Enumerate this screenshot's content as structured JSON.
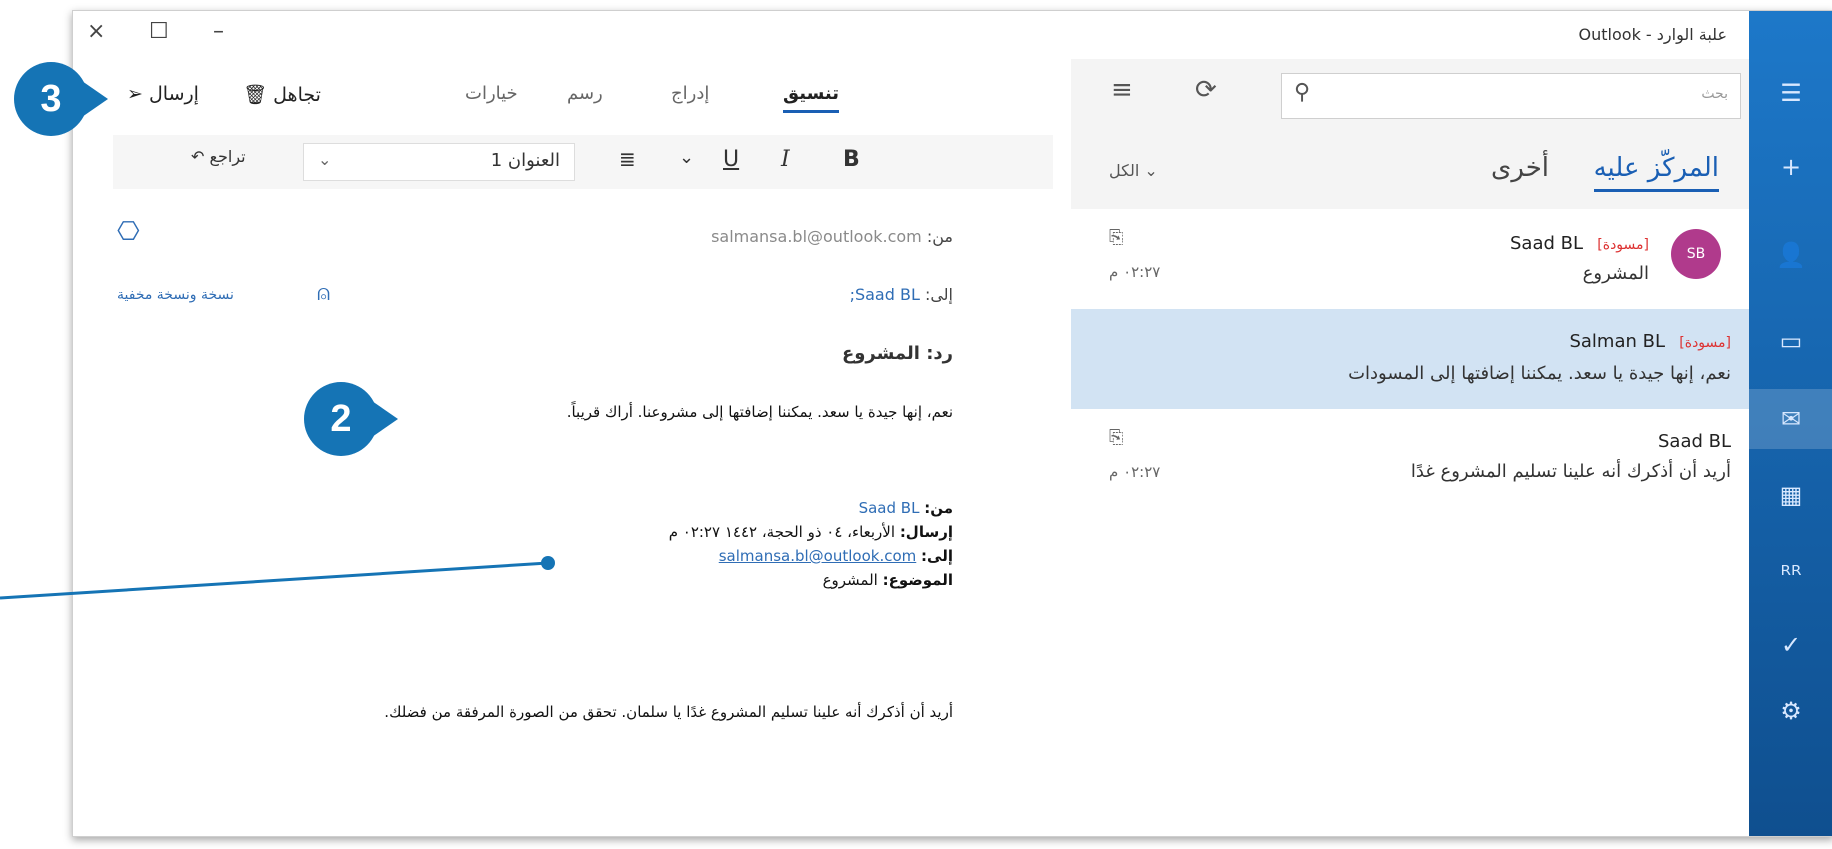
{
  "window": {
    "title": "علبة الوارد - Outlook",
    "controls": {
      "close": "×",
      "maximize": "☐",
      "minimize": "–"
    }
  },
  "rail": {
    "items": [
      {
        "name": "hamburger-icon",
        "glyph": "☰"
      },
      {
        "name": "new-mail-icon",
        "glyph": "+"
      },
      {
        "name": "person-icon",
        "glyph": "👤"
      },
      {
        "name": "folder-icon",
        "glyph": "▭"
      },
      {
        "name": "mail-icon",
        "glyph": "✉"
      },
      {
        "name": "calendar-icon",
        "glyph": "▦"
      },
      {
        "name": "people-icon",
        "glyph": "ᴿᴿ"
      },
      {
        "name": "todo-icon",
        "glyph": "✓"
      },
      {
        "name": "settings-icon",
        "glyph": "⚙"
      }
    ]
  },
  "inbox": {
    "search_placeholder": "بحث",
    "tabs": {
      "focused": "المركّز عليه",
      "other": "أخرى"
    },
    "filter": "الكل",
    "messages": [
      {
        "sender": "Saad BL",
        "draft": "[مسودة]",
        "subject": "المشروع",
        "time": "٠٢:٢٧ م",
        "avatar": "SB"
      },
      {
        "sender": "Salman BL",
        "draft": "[مسودة]",
        "subject": "نعم، إنها جيدة يا سعد. يمكننا إضافتها إلى المسودات"
      },
      {
        "sender": "Saad BL",
        "subject": "أريد أن أذكرك أنه علينا تسليم المشروع غدًا",
        "time": "٠٢:٢٧ م"
      }
    ]
  },
  "compose": {
    "tabs": {
      "format": "تنسيق",
      "insert": "إدراج",
      "draw": "رسم",
      "options": "خيارات"
    },
    "discard_label": "تجاهل",
    "send_label": "إرسال",
    "format": {
      "bold": "B",
      "italic": "I",
      "underline": "U",
      "style": "العنوان 1",
      "undo": "تراجع"
    },
    "from_label": "من:",
    "from_value": "salmansa.bl@outlook.com",
    "to_label": "إلى:",
    "to_value": "Saad BL;",
    "cc_label": "نسخة ونسخة مخفية",
    "subject": "رد: المشروع",
    "reply_text": "نعم، إنها جيدة يا سعد. يمكننا إضافتها إلى مشروعنا. أراك قريباً.",
    "quoted": {
      "from_label": "من:",
      "from_value": "Saad BL",
      "sent_label": "إرسال:",
      "sent_value": "الأربعاء، ٠٤ ذو الحجة، ١٤٤٢ ٠٢:٢٧ م",
      "to_label": "إلى:",
      "to_value": "salmansa.bl@outlook.com",
      "subject_label": "الموضوع:",
      "subject_value": "المشروع",
      "body": "أريد أن أذكرك أنه علينا تسليم المشروع غدًا يا سلمان. تحقق من الصورة المرفقة من فضلك."
    }
  },
  "callouts": {
    "step2": "2",
    "step3": "3"
  },
  "colors": {
    "accent": "#1a5fb4",
    "callout": "#1574b5",
    "rail": "#0f4f8f",
    "selected_row": "#d2e3f3"
  }
}
